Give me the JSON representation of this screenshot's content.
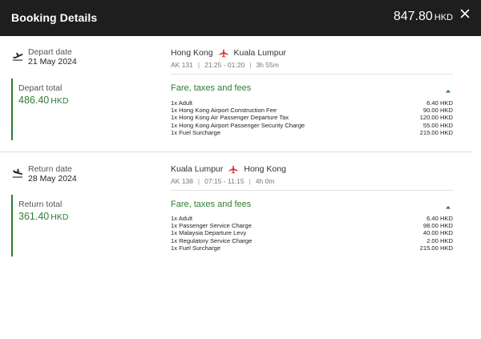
{
  "header": {
    "title": "Booking Details",
    "total_amount": "847.80",
    "total_currency": "HKD"
  },
  "depart": {
    "date_label": "Depart date",
    "date_value": "21 May 2024",
    "from": "Hong Kong",
    "to": "Kuala Lumpur",
    "flight_no": "AK 131",
    "times": "21:25 - 01:20",
    "duration": "3h 55m",
    "total_label": "Depart total",
    "total_amount": "486.40",
    "total_currency": "HKD",
    "fare_heading": "Fare, taxes and fees",
    "fares": [
      {
        "label": "1x Adult",
        "amount": "6.40 HKD"
      },
      {
        "label": "1x Hong Kong Airport Construction Fee",
        "amount": "90.00 HKD"
      },
      {
        "label": "1x Hong Kong Air Passenger Departure Tax",
        "amount": "120.00 HKD"
      },
      {
        "label": "1x Hong Kong Airport Passenger Security Charge",
        "amount": "55.00 HKD"
      },
      {
        "label": "1x Fuel Surcharge",
        "amount": "215.00 HKD"
      }
    ]
  },
  "return": {
    "date_label": "Return date",
    "date_value": "28 May 2024",
    "from": "Kuala Lumpur",
    "to": "Hong Kong",
    "flight_no": "AK 138",
    "times": "07:15 - 11:15",
    "duration": "4h 0m",
    "total_label": "Return total",
    "total_amount": "361.40",
    "total_currency": "HKD",
    "fare_heading": "Fare, taxes and fees",
    "fares": [
      {
        "label": "1x Adult",
        "amount": "6.40 HKD"
      },
      {
        "label": "1x Passenger Service Charge",
        "amount": "98.00 HKD"
      },
      {
        "label": "1x Malaysia Departure Levy",
        "amount": "40.00 HKD"
      },
      {
        "label": "1x Regulatory Service Charge",
        "amount": "2.00 HKD"
      },
      {
        "label": "1x Fuel Surcharge",
        "amount": "215.00 HKD"
      }
    ]
  },
  "colors": {
    "header_bg": "#1e1e1e",
    "accent_green": "#2e7d32",
    "airline_red": "#d32f2f"
  },
  "icons": {
    "depart": "plane-takeoff-icon",
    "return": "plane-landing-icon",
    "route": "airline-plane-icon",
    "close": "close-icon",
    "collapse": "chevron-up-icon"
  }
}
